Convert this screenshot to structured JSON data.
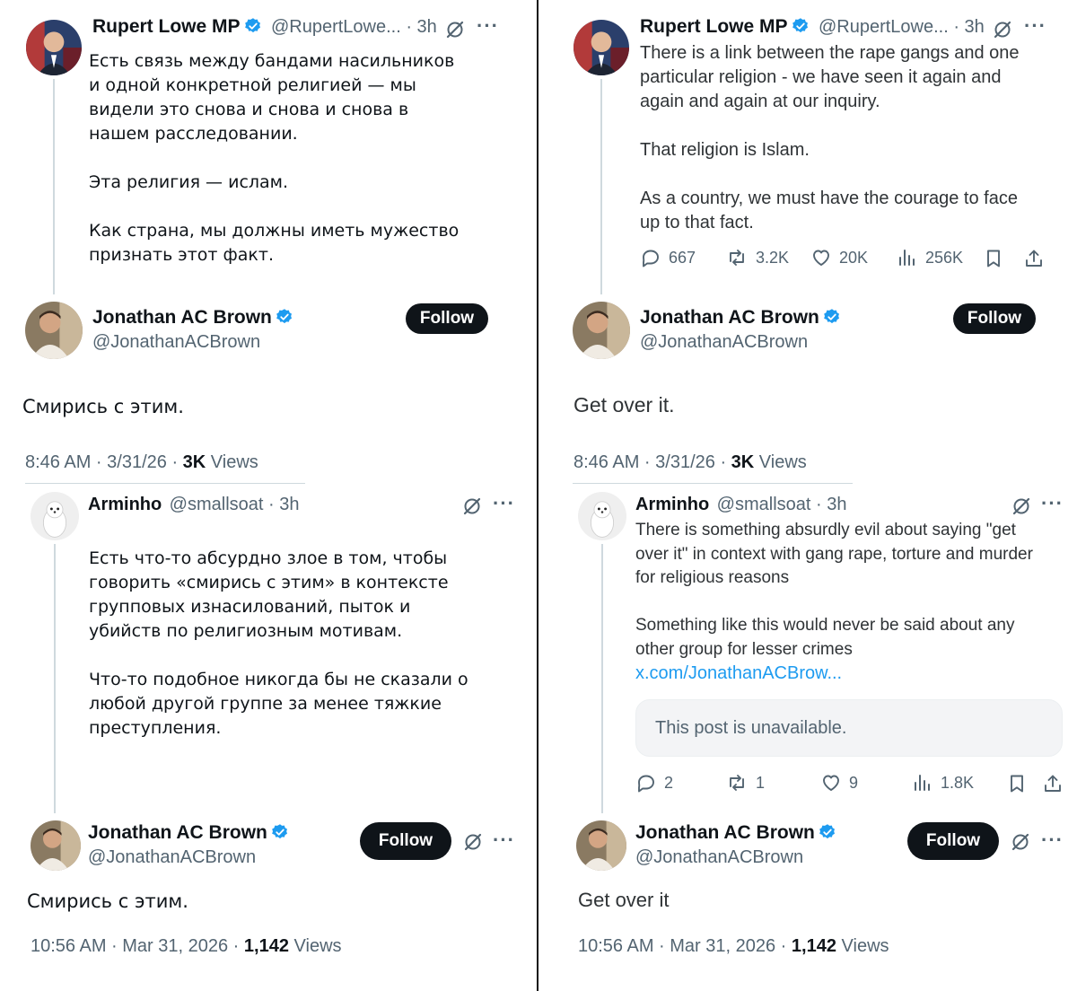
{
  "colors": {
    "accent": "#1d9bf0",
    "text": "#0f1419",
    "muted": "#536471",
    "button_bg": "#0f1419"
  },
  "left": {
    "tweet1": {
      "author_name": "Rupert Lowe MP",
      "handle_time": "@RupertLowe... · 3h",
      "text": "Есть связь между бандами насильников\nи одной конкретной религией — мы\nвидели это снова и снова и снова в\nнашем расследовании.\n\nЭта религия — ислам.\n\nКак страна, мы должны иметь мужество\nпризнать этот факт."
    },
    "reply1": {
      "author_name": "Jonathan AC Brown",
      "handle": "@JonathanACBrown",
      "follow_label": "Follow",
      "text": "Смирись с этим.",
      "time": "8:46 AM · 3/31/26 · ",
      "views_count": "3K",
      "views_label": " Views"
    },
    "tweet2": {
      "author_name": "Arminho",
      "handle_time": "@smallsoat · 3h",
      "text": "Есть что-то абсурдно злое в том, чтобы\nговорить «смирись с этим» в контексте\nгрупповых изнасилований, пыток и\nубийств по религиозным мотивам.\n\nЧто-то подобное никогда бы не сказали о\nлюбой другой группе за менее тяжкие\nпреступления."
    },
    "reply2": {
      "author_name": "Jonathan AC Brown",
      "handle": "@JonathanACBrown",
      "follow_label": "Follow",
      "text": "Смирись с этим.",
      "time": "10:56 AM · Mar 31, 2026 · ",
      "views_count": "1,142",
      "views_label": " Views"
    }
  },
  "right": {
    "tweet1": {
      "author_name": "Rupert Lowe MP",
      "handle_time": "@RupertLowe... · 3h",
      "text": "There is a link between the rape gangs and one\nparticular religion - we have seen it again and\nagain and again at our inquiry.\n\nThat religion is Islam.\n\nAs a country, we must have the courage to face\nup to that fact.",
      "stats": {
        "replies": "667",
        "reposts": "3.2K",
        "likes": "20K",
        "views": "256K"
      }
    },
    "reply1": {
      "author_name": "Jonathan AC Brown",
      "handle": "@JonathanACBrown",
      "follow_label": "Follow",
      "text": "Get over it.",
      "time": "8:46 AM · 3/31/26 · ",
      "views_count": "3K",
      "views_label": " Views"
    },
    "tweet2": {
      "author_name": "Arminho",
      "handle_time": "@smallsoat · 3h",
      "text": "There is something absurdly evil about saying \"get\nover it\" in context with gang rape, torture and murder\nfor religious reasons\n\nSomething like this would never be said about any\nother group for lesser crimes",
      "link": "x.com/JonathanACBrow...",
      "quote": "This post is unavailable.",
      "stats": {
        "replies": "2",
        "reposts": "1",
        "likes": "9",
        "views": "1.8K"
      }
    },
    "reply2": {
      "author_name": "Jonathan AC Brown",
      "handle": "@JonathanACBrown",
      "follow_label": "Follow",
      "text": "Get over it",
      "time": "10:56 AM · Mar 31, 2026 · ",
      "views_count": "1,142",
      "views_label": " Views"
    }
  }
}
